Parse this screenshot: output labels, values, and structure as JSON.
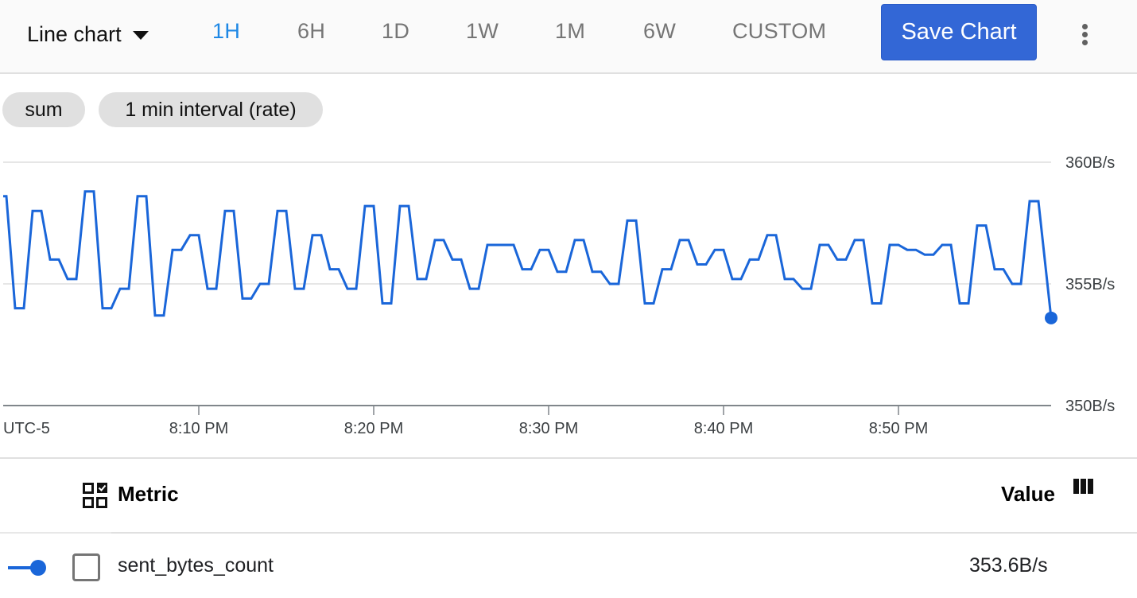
{
  "toolbar": {
    "chart_type": "Line chart",
    "ranges": [
      {
        "label": "1H",
        "active": true
      },
      {
        "label": "6H",
        "active": false
      },
      {
        "label": "1D",
        "active": false
      },
      {
        "label": "1W",
        "active": false
      },
      {
        "label": "1M",
        "active": false
      },
      {
        "label": "6W",
        "active": false
      },
      {
        "label": "CUSTOM",
        "active": false
      }
    ],
    "save_label": "Save Chart",
    "more_icon": "more-vert-icon"
  },
  "chips": {
    "aggregation": "sum",
    "interval": "1 min interval (rate)"
  },
  "colors": {
    "series": "#1a66d9",
    "accent": "#1e88e5",
    "button": "#3367d6",
    "grid": "#e6e6e6",
    "axis": "#80868b"
  },
  "chart_data": {
    "type": "line",
    "title": "",
    "xlabel": "",
    "ylabel": "",
    "timezone_label": "UTC-5",
    "x_ticks": [
      "8:10 PM",
      "8:20 PM",
      "8:30 PM",
      "8:40 PM",
      "8:50 PM"
    ],
    "y_ticks": [
      "360B/s",
      "355B/s",
      "350B/s"
    ],
    "y_tick_values": [
      360,
      355,
      350
    ],
    "ylim": [
      350,
      360
    ],
    "unit": "B/s",
    "x_start": "7:59 PM",
    "x_step_minutes": 1,
    "grid": true,
    "series": [
      {
        "name": "sent_bytes_count",
        "values": [
          358.6,
          354.0,
          358.0,
          356.0,
          355.2,
          358.8,
          354.0,
          354.8,
          358.6,
          353.7,
          356.4,
          357.0,
          354.8,
          358.0,
          354.4,
          355.0,
          358.0,
          354.8,
          357.0,
          355.6,
          354.8,
          358.2,
          354.2,
          358.2,
          355.2,
          356.8,
          356.0,
          354.8,
          356.6,
          356.6,
          355.6,
          356.4,
          355.5,
          356.8,
          355.5,
          355.0,
          357.6,
          354.2,
          355.6,
          356.8,
          355.8,
          356.4,
          355.2,
          356.0,
          357.0,
          355.2,
          354.8,
          356.6,
          356.0,
          356.8,
          354.2,
          356.6,
          356.4,
          356.2,
          356.6,
          354.2,
          357.4,
          355.6,
          355.0,
          358.4,
          353.6
        ]
      }
    ]
  },
  "table": {
    "metric_header": "Metric",
    "value_header": "Value",
    "rows": [
      {
        "name": "sent_bytes_count",
        "value": "353.6B/s"
      }
    ]
  }
}
